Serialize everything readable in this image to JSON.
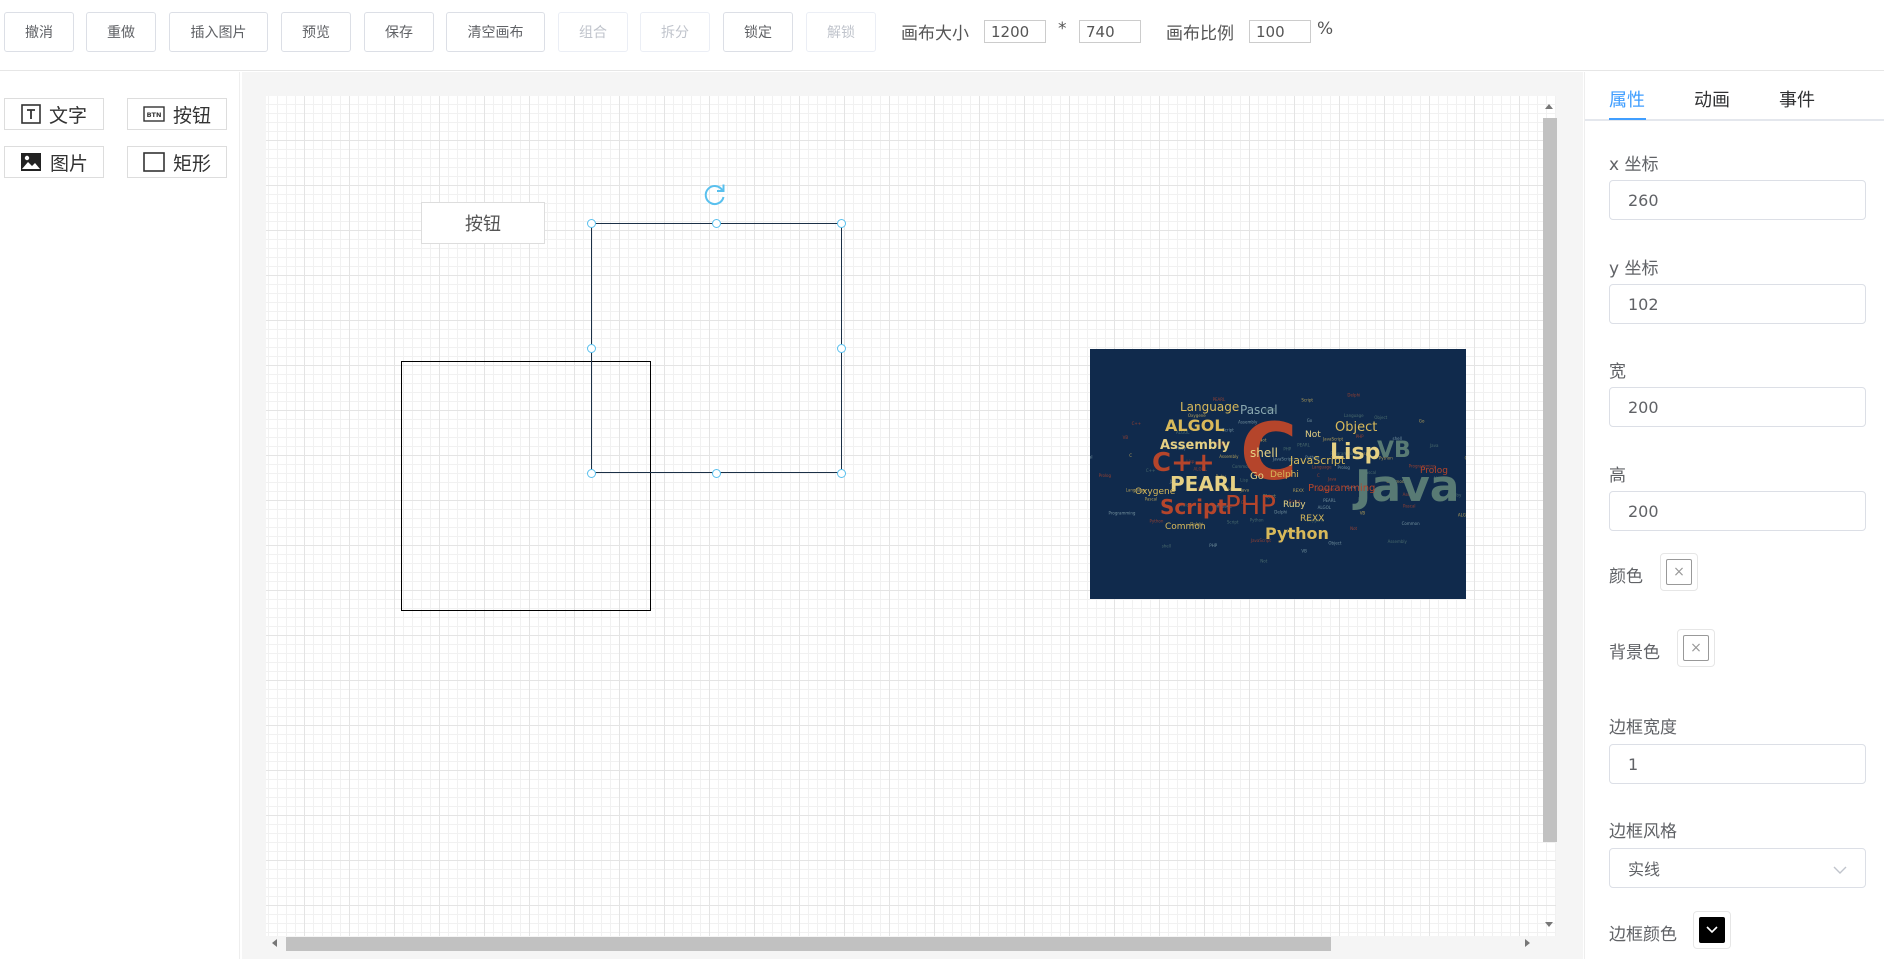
{
  "toolbar": {
    "undo": "撤消",
    "redo": "重做",
    "insert_image": "插入图片",
    "preview": "预览",
    "save": "保存",
    "clear_canvas": "清空画布",
    "group": "组合",
    "ungroup": "拆分",
    "lock": "锁定",
    "unlock": "解锁",
    "canvas_size_label": "画布大小",
    "canvas_width": "1200",
    "times": "*",
    "canvas_height": "740",
    "canvas_scale_label": "画布比例",
    "canvas_scale": "100",
    "percent": "%"
  },
  "components": {
    "text": "文字",
    "button": "按钮",
    "image": "图片",
    "rect": "矩形",
    "btn_icon_text": "BTN"
  },
  "canvas": {
    "button_label": "按钮",
    "wordcloud": {
      "background": "#102a4c",
      "words": [
        "C",
        "Java",
        "PHP",
        "PEARL",
        "ALGOL",
        "Lisp",
        "Python",
        "Script",
        "Assembly",
        "Pascal",
        "Language",
        "Object",
        "VB",
        "C++",
        "shell",
        "JavaScript",
        "Oxygene",
        "Ruby",
        "Programming",
        "Delphi",
        "REXX",
        "Common",
        "Prolog",
        "Go",
        "Not"
      ]
    }
  },
  "panel": {
    "tabs": [
      "属性",
      "动画",
      "事件"
    ],
    "active_tab": "属性",
    "x_label": "x 坐标",
    "x_value": "260",
    "y_label": "y 坐标",
    "y_value": "102",
    "width_label": "宽",
    "width_value": "200",
    "height_label": "高",
    "height_value": "200",
    "color_label": "颜色",
    "bg_color_label": "背景色",
    "border_width_label": "边框宽度",
    "border_width_value": "1",
    "border_style_label": "边框风格",
    "border_style_value": "实线",
    "border_color_label": "边框颜色",
    "border_color_value": "#000000",
    "empty_swatch_glyph": "×"
  },
  "colors": {
    "accent": "#409eff",
    "handle": "#59c0ee",
    "selected_border": "#1b3047"
  }
}
